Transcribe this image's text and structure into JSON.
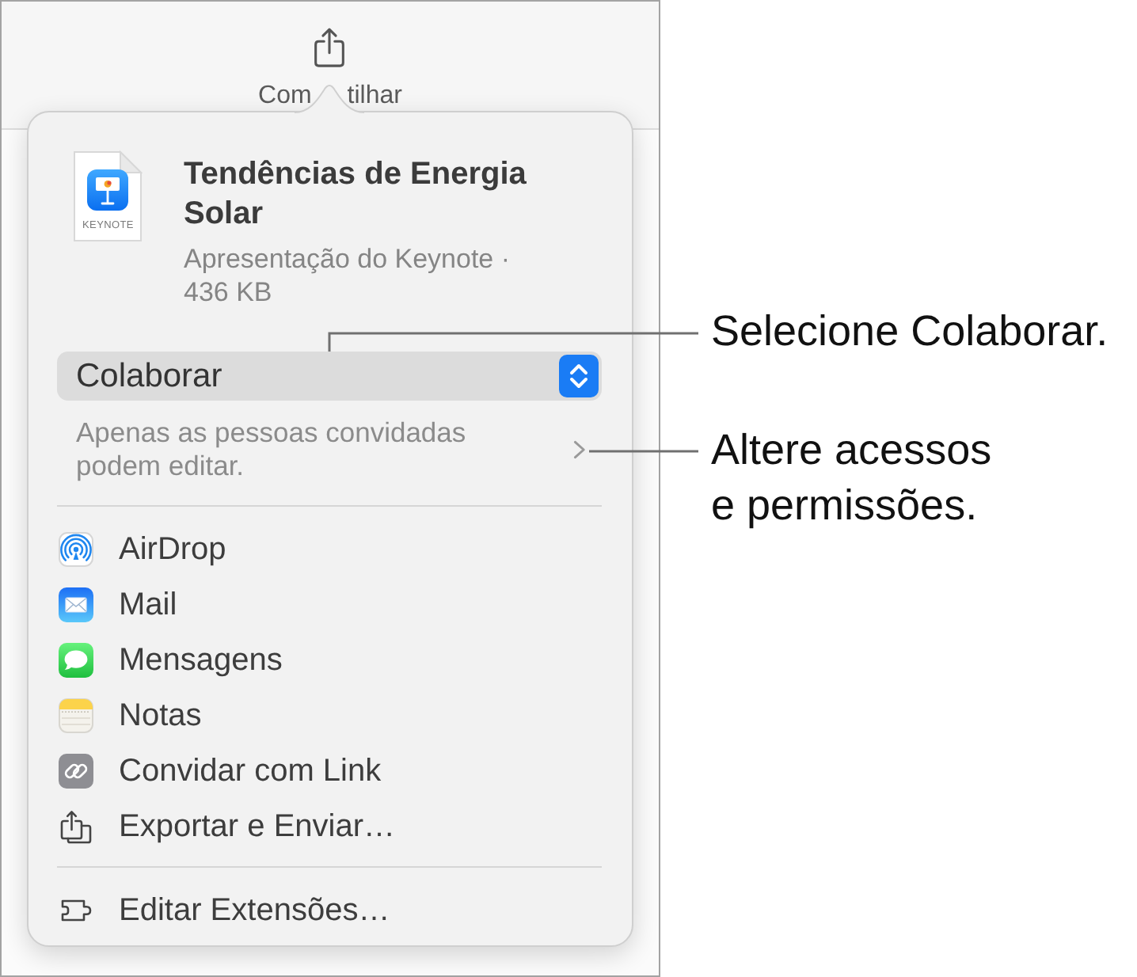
{
  "window": {
    "toolbar": {
      "share_button": {
        "label_fragments": [
          "Com",
          "tilhar"
        ]
      }
    }
  },
  "share_popover": {
    "document": {
      "file_type": "KEYNOTE",
      "title": "Tendências de Energia Solar",
      "subtitle": "Apresentação do Keynote · 436 KB"
    },
    "access_mode": {
      "value": "Colaborar"
    },
    "permissions": {
      "description": "Apenas as pessoas convidadas podem editar."
    },
    "share_options": [
      {
        "label": "AirDrop"
      },
      {
        "label": "Mail"
      },
      {
        "label": "Mensagens"
      },
      {
        "label": "Notas"
      },
      {
        "label": "Convidar com Link"
      },
      {
        "label": "Exportar e Enviar…"
      }
    ],
    "footer_option": {
      "label": "Editar Extensões…"
    }
  },
  "callouts": [
    {
      "text": "Selecione Colaborar."
    },
    {
      "text": "Altere acessos\ne permissões."
    }
  ]
}
